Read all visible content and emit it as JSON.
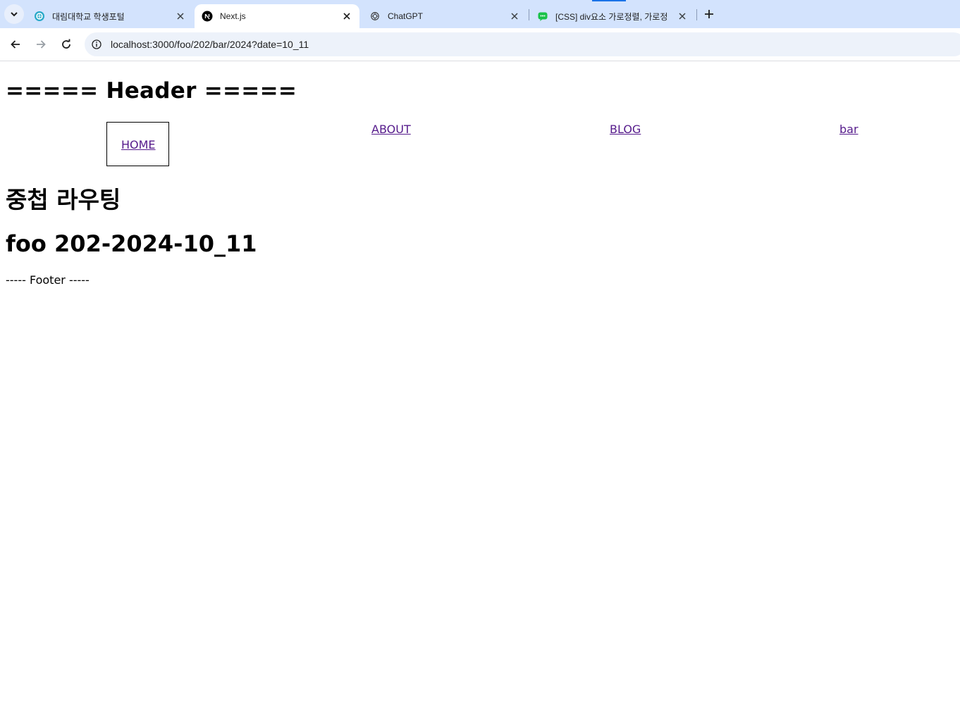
{
  "browser": {
    "tabs": [
      {
        "title": "대림대학교 학생포털",
        "favicon": "school-favicon",
        "active": false
      },
      {
        "title": "Next.js",
        "favicon": "nextjs-favicon",
        "active": true
      },
      {
        "title": "ChatGPT",
        "favicon": "chatgpt-favicon",
        "active": false
      },
      {
        "title": "[CSS] div요소 가로정렬, 가로정",
        "favicon": "blog-favicon",
        "active": false
      }
    ],
    "address_bar": {
      "url": "localhost:3000/foo/202/bar/2024?date=10_11"
    },
    "colors": {
      "tabstrip": "#d3e3fd",
      "omnibox": "#edf2fa",
      "link_visited": "#551a8b"
    }
  },
  "page": {
    "header": "===== Header =====",
    "nav": {
      "home": "HOME",
      "about": "ABOUT",
      "blog": "BLOG",
      "bar": "bar"
    },
    "heading": "중첩 라우팅",
    "params_heading": "foo 202-2024-10_11",
    "footer": "----- Footer -----"
  }
}
